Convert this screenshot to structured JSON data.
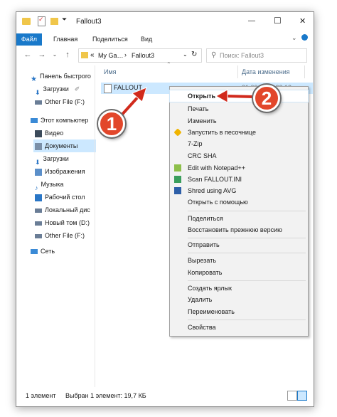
{
  "window": {
    "title": "Fallout3",
    "controls": {
      "minimize": "—",
      "maximize": "☐",
      "close": "✕"
    }
  },
  "ribbon": {
    "file": "Файл",
    "tabs": [
      "Главная",
      "Поделиться",
      "Вид"
    ]
  },
  "address": {
    "overflow": "«",
    "parts": [
      "My Ga…",
      "Fallout3"
    ],
    "sep": "›",
    "search_placeholder": "Поиск: Fallout3"
  },
  "nav": {
    "items": [
      {
        "label": "Панель быстрого",
        "icon": "star-icon"
      },
      {
        "label": "Загрузки",
        "icon": "download-icon"
      },
      {
        "label": "Other File (F:)",
        "icon": "drive-icon"
      },
      {
        "label": "Этот компьютер",
        "icon": "computer-icon"
      },
      {
        "label": "Видео",
        "icon": "video-icon"
      },
      {
        "label": "Документы",
        "icon": "documents-icon"
      },
      {
        "label": "Загрузки",
        "icon": "download-icon"
      },
      {
        "label": "Изображения",
        "icon": "pictures-icon"
      },
      {
        "label": "Музыка",
        "icon": "music-icon"
      },
      {
        "label": "Рабочий стол",
        "icon": "desktop-icon"
      },
      {
        "label": "Локальный дис",
        "icon": "drive-icon"
      },
      {
        "label": "Новый том (D:)",
        "icon": "drive-icon"
      },
      {
        "label": "Other File (F:)",
        "icon": "drive-icon"
      },
      {
        "label": "Сеть",
        "icon": "network-icon"
      }
    ]
  },
  "columns": {
    "name": "Имя",
    "date": "Дата изменения"
  },
  "file": {
    "name": "FALLOUT",
    "date": "21.09.2017 22:12"
  },
  "context_menu": [
    "Открыть",
    "Печать",
    "Изменить",
    "Запустить в песочнице",
    "7-Zip",
    "CRC SHA",
    "Edit with Notepad++",
    "Scan FALLOUT.INI",
    "Shred using AVG",
    "Открыть с помощью",
    "Поделиться",
    "Восстановить прежнюю версию",
    "Отправить",
    "Вырезать",
    "Копировать",
    "Создать ярлык",
    "Удалить",
    "Переименовать",
    "Свойства"
  ],
  "status": {
    "count": "1 элемент",
    "selected": "Выбран 1 элемент: 19,7 КБ"
  },
  "annotations": {
    "step1": "1",
    "step2": "2"
  },
  "colors": {
    "accent": "#1979ca",
    "selection": "#cce8ff",
    "callout": "#e2472b",
    "arrow": "#d12a1c"
  }
}
